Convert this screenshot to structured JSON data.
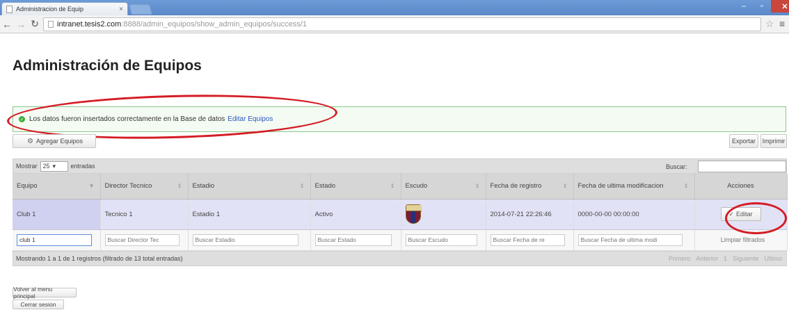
{
  "browser": {
    "tab_title": "Administracion de Equip",
    "tab_close": "×",
    "url_host": "intranet.tesis2.com",
    "url_path": ":8888/admin_equipos/show_admin_equipos/success/1"
  },
  "page": {
    "title": "Administración de Equipos"
  },
  "alert": {
    "message": "Los datos fueron insertados correctamente en la Base de datos",
    "link": "Editar Equipos"
  },
  "toolbar": {
    "add_label": "Agregar Equipos",
    "export_label": "Exportar",
    "print_label": "Imprimir"
  },
  "table_controls": {
    "show_label": "Mostrar",
    "page_size": "25",
    "entries_label": "entradas",
    "search_label": "Buscar:"
  },
  "table": {
    "headers": [
      "Equipo",
      "Director Tecnico",
      "Estadio",
      "Estado",
      "Escudo",
      "Fecha de registro",
      "Fecha de ultima modificacion",
      "Acciones"
    ],
    "rows": [
      {
        "equipo": "Club 1",
        "director": "Tecnico 1",
        "estadio": "Estadio 1",
        "estado": "Activo",
        "fecha_registro": "2014-07-21 22:26:46",
        "fecha_modificacion": "0000-00-00 00:00:00",
        "accion": "Editar"
      }
    ],
    "filters": {
      "equipo_value": "club 1",
      "director_placeholder": "Buscar Director Tec",
      "estadio_placeholder": "Buscar Estadio",
      "estado_placeholder": "Buscar Estado",
      "escudo_placeholder": "Buscar Escudo",
      "registro_placeholder": "Buscar Fecha de re",
      "modificacion_placeholder": "Buscar Fecha de ultima modi",
      "clear_label": "Limpiar filtrados"
    },
    "info": "Mostrando 1 a 1 de 1 registros (filtrado de 13 total entradas)",
    "pager": [
      "Primero",
      "Anterior",
      "1",
      "Siguiente",
      "Ultimo"
    ]
  },
  "footer_buttons": {
    "menu_label": "Volver al menu principal",
    "logout_label": "Cerrar sesion"
  }
}
